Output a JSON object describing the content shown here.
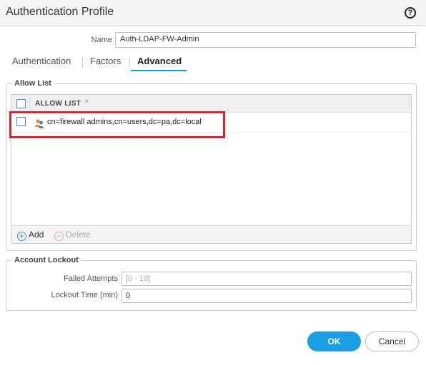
{
  "dialog": {
    "title": "Authentication Profile",
    "help_icon": "question-circle-icon",
    "help_glyph": "?"
  },
  "name_field": {
    "label": "Name",
    "value": "Auth-LDAP-FW-Admin"
  },
  "tabs": [
    {
      "label": "Authentication",
      "active": false
    },
    {
      "label": "Factors",
      "active": false
    },
    {
      "label": "Advanced",
      "active": true
    }
  ],
  "allow_list": {
    "section_title": "Allow List",
    "column_header": "ALLOW LIST",
    "sort_glyph": "^",
    "rows": [
      {
        "value": "cn=firewall admins,cn=users,dc=pa,dc=local",
        "icon": "user-group-icon"
      }
    ],
    "add_label": "Add",
    "add_glyph": "+",
    "delete_label": "Delete",
    "delete_glyph": "−"
  },
  "account_lockout": {
    "section_title": "Account Lockout",
    "failed_attempts": {
      "label": "Failed Attempts",
      "placeholder": "[0 - 10]",
      "value": ""
    },
    "lockout_time": {
      "label": "Lockout Time (min)",
      "value": "0"
    }
  },
  "buttons": {
    "ok": "OK",
    "cancel": "Cancel"
  },
  "colors": {
    "accent": "#1b9ee3",
    "tab_underline": "#0aa0d8",
    "highlight_box": "#e0202a"
  }
}
